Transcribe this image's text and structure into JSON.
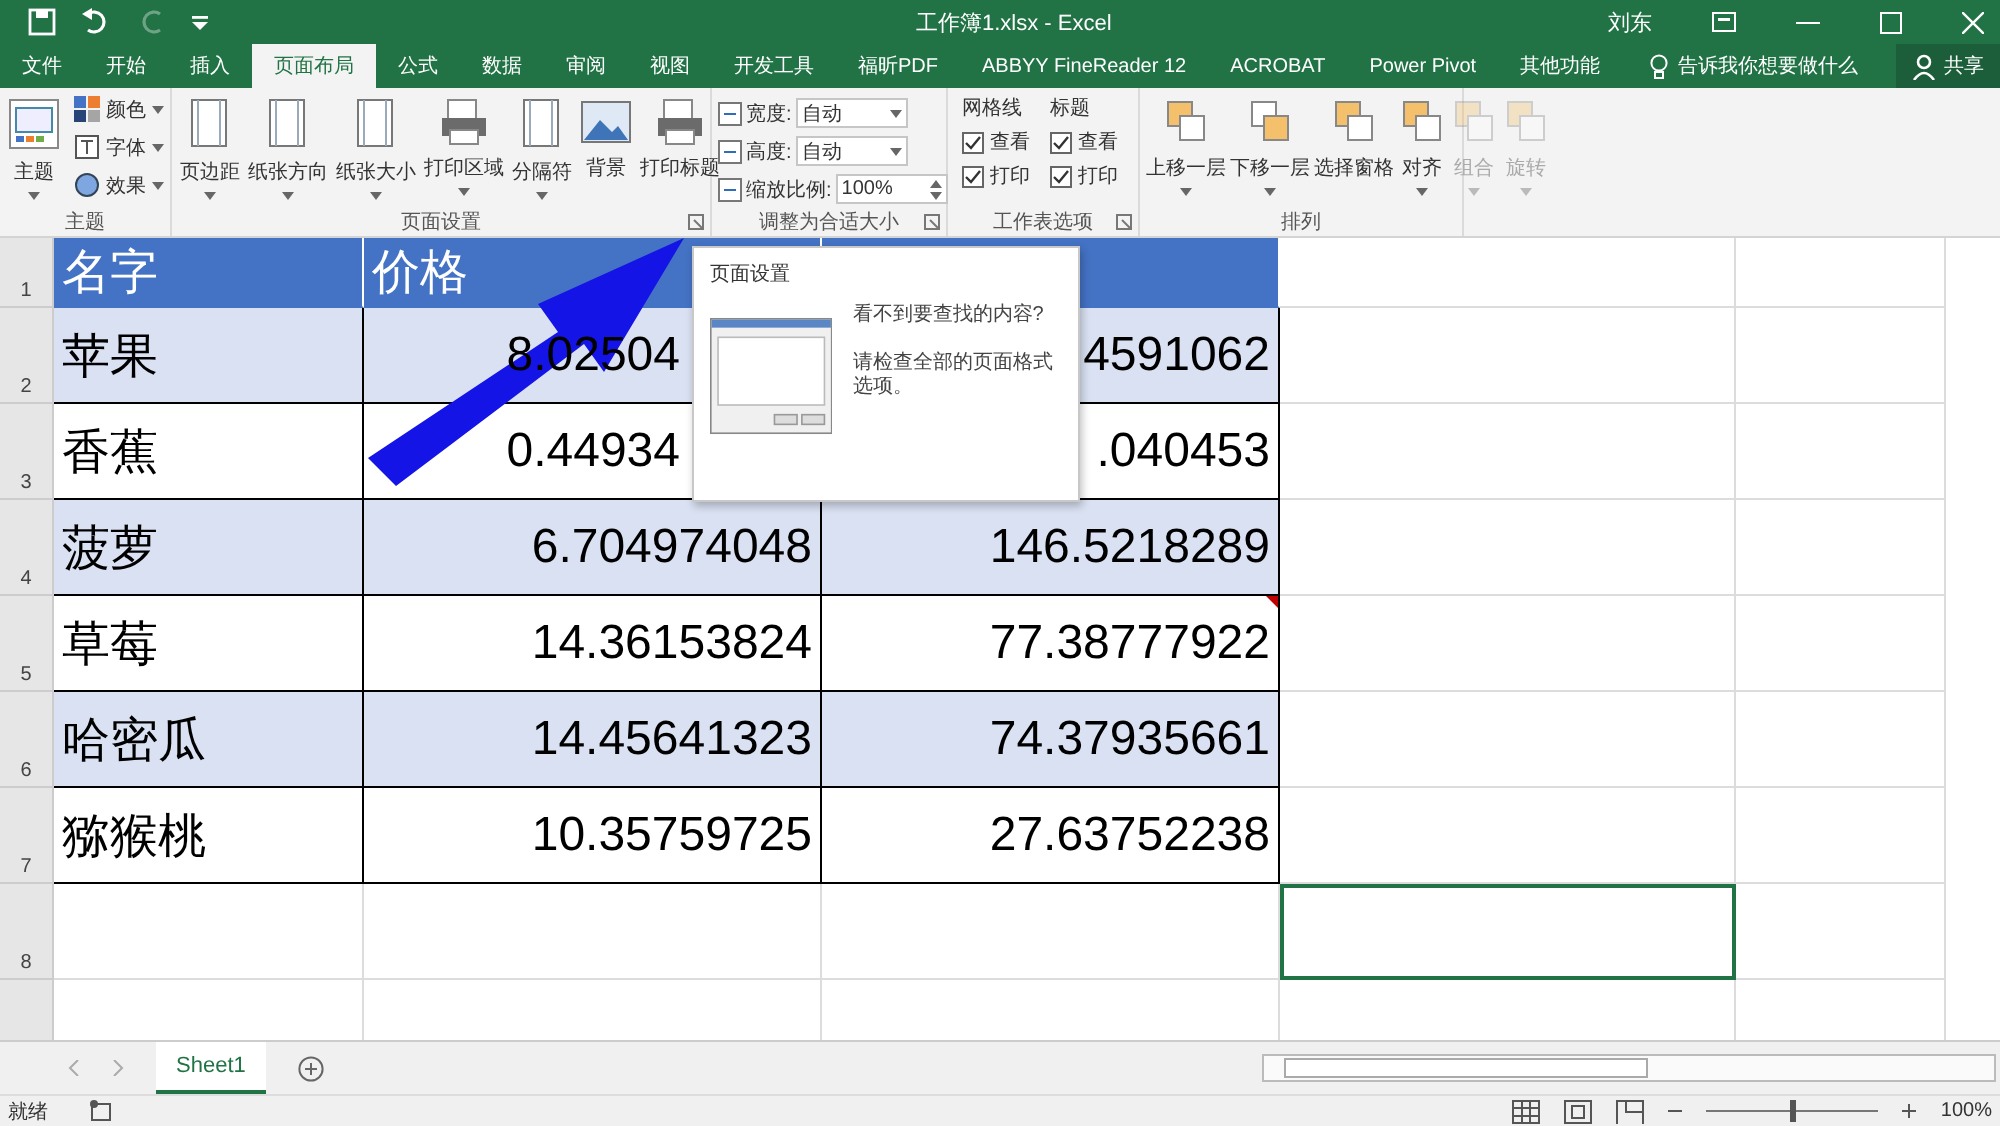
{
  "window": {
    "title": "工作簿1.xlsx  -  Excel",
    "user": "刘东"
  },
  "tabs": [
    {
      "label": "文件",
      "selected": false
    },
    {
      "label": "开始",
      "selected": false
    },
    {
      "label": "插入",
      "selected": false
    },
    {
      "label": "页面布局",
      "selected": true
    },
    {
      "label": "公式",
      "selected": false
    },
    {
      "label": "数据",
      "selected": false
    },
    {
      "label": "审阅",
      "selected": false
    },
    {
      "label": "视图",
      "selected": false
    },
    {
      "label": "开发工具",
      "selected": false
    },
    {
      "label": "福昕PDF",
      "selected": false
    },
    {
      "label": "ABBYY FineReader 12",
      "selected": false
    },
    {
      "label": "ACROBAT",
      "selected": false
    },
    {
      "label": "Power Pivot",
      "selected": false
    },
    {
      "label": "其他功能",
      "selected": false
    }
  ],
  "tell_me": "告诉我你想要做什么",
  "share": "共享",
  "ribbon": {
    "themes": {
      "label": "主题",
      "big": "主题",
      "items": [
        "颜色",
        "字体",
        "效果"
      ]
    },
    "page_setup": {
      "label": "页面设置",
      "buttons": [
        {
          "label": "页边距",
          "dropdown": true
        },
        {
          "label": "纸张方向",
          "dropdown": true
        },
        {
          "label": "纸张大小",
          "dropdown": true
        },
        {
          "label": "打印区域",
          "dropdown": true
        },
        {
          "label": "分隔符",
          "dropdown": true
        },
        {
          "label": "背景",
          "dropdown": false
        },
        {
          "label": "打印标题",
          "dropdown": false
        }
      ]
    },
    "scale": {
      "label": "调整为合适大小",
      "fields": [
        {
          "label": "宽度:",
          "value": "自动"
        },
        {
          "label": "高度:",
          "value": "自动"
        },
        {
          "label": "缩放比例:",
          "value": "100%"
        }
      ]
    },
    "sheet_options": {
      "label": "工作表选项",
      "columns": [
        {
          "title": "网格线",
          "options": [
            {
              "label": "查看",
              "checked": true
            },
            {
              "label": "打印",
              "checked": true
            }
          ]
        },
        {
          "title": "标题",
          "options": [
            {
              "label": "查看",
              "checked": true
            },
            {
              "label": "打印",
              "checked": true
            }
          ]
        }
      ]
    },
    "arrange": {
      "label": "排列",
      "buttons": [
        {
          "label": "上移一层",
          "disabled": false
        },
        {
          "label": "下移一层",
          "disabled": false
        },
        {
          "label": "选择窗格",
          "disabled": false
        },
        {
          "label": "对齐",
          "disabled": false
        },
        {
          "label": "组合",
          "disabled": true
        },
        {
          "label": "旋转",
          "disabled": true
        }
      ]
    }
  },
  "sheet": {
    "rows": [
      {
        "header": "1",
        "kind": "header",
        "cells": [
          {
            "text": "名字",
            "selected": false,
            "comment": false
          },
          {
            "text": "价格",
            "selected": false,
            "comment": false
          },
          {
            "selected": false,
            "comment": false
          },
          {
            "selected": false,
            "comment": false
          },
          {
            "selected": false,
            "comment": false
          }
        ]
      },
      {
        "header": "2",
        "kind": "band",
        "cells": [
          {
            "text": "苹果",
            "selected": false,
            "comment": false
          },
          {
            "text": "8.02504",
            "selected": false
          },
          {
            "text": "4591062",
            "selected": false,
            "comment": false
          },
          {
            "selected": false,
            "comment": false
          },
          {
            "selected": false,
            "comment": false
          }
        ]
      },
      {
        "header": "3",
        "kind": "plain",
        "cells": [
          {
            "text": "香蕉",
            "selected": false,
            "comment": false
          },
          {
            "text": "0.44934",
            "selected": false
          },
          {
            "text": ".040453",
            "selected": false,
            "comment": false
          },
          {
            "selected": false,
            "comment": false
          },
          {
            "selected": false,
            "comment": false
          }
        ]
      },
      {
        "header": "4",
        "kind": "band",
        "cells": [
          {
            "text": "菠萝",
            "selected": false,
            "comment": false
          },
          {
            "text": "6.704974048",
            "selected": false,
            "comment": false
          },
          {
            "text": "146.5218289",
            "selected": false,
            "comment": false
          },
          {
            "selected": false,
            "comment": false
          },
          {
            "selected": false,
            "comment": false
          }
        ]
      },
      {
        "header": "5",
        "kind": "plain",
        "cells": [
          {
            "text": "草莓",
            "selected": false,
            "comment": false
          },
          {
            "text": "14.36153824",
            "selected": false,
            "comment": false
          },
          {
            "text": "77.38777922",
            "selected": false,
            "comment": true
          },
          {
            "selected": false,
            "comment": false
          },
          {
            "selected": false,
            "comment": false
          }
        ]
      },
      {
        "header": "6",
        "kind": "band",
        "cells": [
          {
            "text": "哈密瓜",
            "selected": false,
            "comment": false
          },
          {
            "text": "14.45641323",
            "selected": false,
            "comment": false
          },
          {
            "text": "74.37935661",
            "selected": false,
            "comment": false
          },
          {
            "selected": false,
            "comment": false
          },
          {
            "selected": false,
            "comment": false
          }
        ]
      },
      {
        "header": "7",
        "kind": "plain",
        "cells": [
          {
            "text": "猕猴桃",
            "selected": false,
            "comment": false
          },
          {
            "text": "10.35759725",
            "selected": false,
            "comment": false
          },
          {
            "text": "27.63752238",
            "selected": false,
            "comment": false
          },
          {
            "selected": false,
            "comment": false
          },
          {
            "selected": false,
            "comment": false
          }
        ]
      },
      {
        "header": "8",
        "kind": "empty",
        "cells": [
          {
            "selected": false,
            "comment": false
          },
          {
            "selected": false,
            "comment": false
          },
          {
            "selected": false,
            "comment": false
          },
          {
            "selected": true,
            "comment": false
          },
          {
            "selected": false,
            "comment": false
          }
        ]
      }
    ]
  },
  "tooltip": {
    "title": "页面设置",
    "lines": [
      "看不到要查找的内容?",
      "请检查全部的页面格式选项。"
    ]
  },
  "sheet_tabs": [
    {
      "label": "Sheet1",
      "selected": true
    }
  ],
  "status_bar": {
    "status": "就绪",
    "zoom": {
      "level": 0.5,
      "reading": "100%"
    }
  }
}
